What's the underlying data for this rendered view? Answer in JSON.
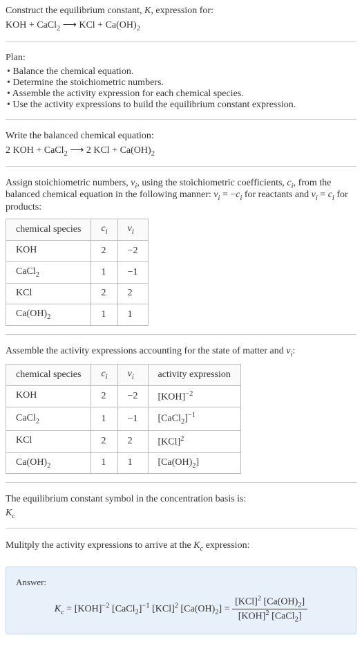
{
  "intro": {
    "line1_a": "Construct the equilibrium constant, ",
    "line1_k": "K",
    "line1_b": ", expression for:",
    "eq_lhs1": "KOH + CaCl",
    "eq_sub1": "2",
    "eq_arrow": " ⟶ ",
    "eq_rhs1": "KCl + Ca(OH)",
    "eq_sub2": "2"
  },
  "plan": {
    "title": "Plan:",
    "items": [
      "• Balance the chemical equation.",
      "• Determine the stoichiometric numbers.",
      "• Assemble the activity expression for each chemical species.",
      "• Use the activity expressions to build the equilibrium constant expression."
    ]
  },
  "balanced": {
    "title": "Write the balanced chemical equation:",
    "eq_a": "2 KOH + CaCl",
    "eq_sub1": "2",
    "eq_arrow": " ⟶ ",
    "eq_b": "2 KCl + Ca(OH)",
    "eq_sub2": "2"
  },
  "stoich": {
    "text_a": "Assign stoichiometric numbers, ",
    "nu": "ν",
    "sub_i": "i",
    "text_b": ", using the stoichiometric coefficients, ",
    "c": "c",
    "text_c": ", from the balanced chemical equation in the following manner: ",
    "eq1_a": "ν",
    "eq1_b": " = −",
    "eq1_c": "c",
    "text_d": " for reactants and ",
    "eq2_a": "ν",
    "eq2_b": " = ",
    "eq2_c": "c",
    "text_e": " for products:",
    "headers": {
      "species": "chemical species",
      "ci": "c",
      "ci_sub": "i",
      "nui": "ν",
      "nui_sub": "i"
    },
    "rows": [
      {
        "species_a": "KOH",
        "species_sub": "",
        "c": "2",
        "nu": "−2"
      },
      {
        "species_a": "CaCl",
        "species_sub": "2",
        "c": "1",
        "nu": "−1"
      },
      {
        "species_a": "KCl",
        "species_sub": "",
        "c": "2",
        "nu": "2"
      },
      {
        "species_a": "Ca(OH)",
        "species_sub": "2",
        "c": "1",
        "nu": "1"
      }
    ]
  },
  "activity": {
    "text_a": "Assemble the activity expressions accounting for the state of matter and ",
    "nu": "ν",
    "sub_i": "i",
    "text_b": ":",
    "headers": {
      "species": "chemical species",
      "ci": "c",
      "ci_sub": "i",
      "nui": "ν",
      "nui_sub": "i",
      "activity": "activity expression"
    },
    "rows": [
      {
        "species_a": "KOH",
        "species_sub": "",
        "c": "2",
        "nu": "−2",
        "act_a": "[KOH]",
        "act_sup": "−2",
        "act_sub": ""
      },
      {
        "species_a": "CaCl",
        "species_sub": "2",
        "c": "1",
        "nu": "−1",
        "act_a": "[CaCl",
        "act_sub": "2",
        "act_b": "]",
        "act_sup": "−1"
      },
      {
        "species_a": "KCl",
        "species_sub": "",
        "c": "2",
        "nu": "2",
        "act_a": "[KCl]",
        "act_sup": "2",
        "act_sub": ""
      },
      {
        "species_a": "Ca(OH)",
        "species_sub": "2",
        "c": "1",
        "nu": "1",
        "act_a": "[Ca(OH)",
        "act_sub": "2",
        "act_b": "]",
        "act_sup": ""
      }
    ]
  },
  "symbol": {
    "text": "The equilibrium constant symbol in the concentration basis is:",
    "k": "K",
    "ksub": "c"
  },
  "multiply": {
    "text_a": "Mulitply the activity expressions to arrive at the ",
    "k": "K",
    "ksub": "c",
    "text_b": " expression:"
  },
  "answer": {
    "label": "Answer:",
    "kc_k": "K",
    "kc_sub": "c",
    "eq": " = ",
    "p1_a": "[KOH]",
    "p1_sup": "−2",
    "sp": " ",
    "p2_a": "[CaCl",
    "p2_sub": "2",
    "p2_b": "]",
    "p2_sup": "−1",
    "p3_a": "[KCl]",
    "p3_sup": "2",
    "p4_a": "[Ca(OH)",
    "p4_sub": "2",
    "p4_b": "]",
    "eq2": " = ",
    "num_a": "[KCl]",
    "num_sup": "2",
    "num_b": " [Ca(OH)",
    "num_sub": "2",
    "num_c": "]",
    "den_a": "[KOH]",
    "den_sup": "2",
    "den_b": " [CaCl",
    "den_sub": "2",
    "den_c": "]"
  }
}
